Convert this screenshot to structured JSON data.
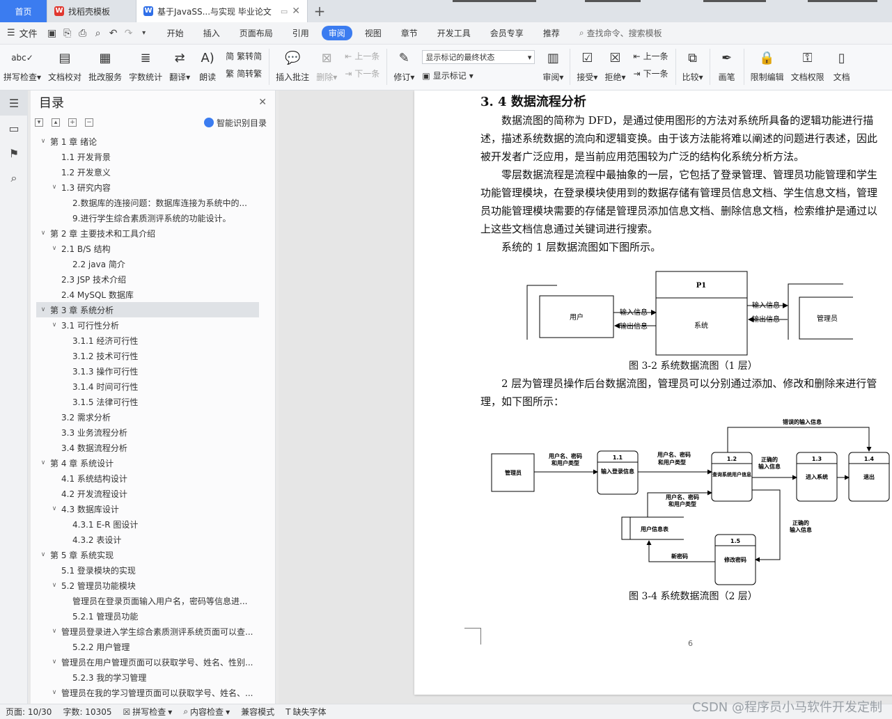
{
  "tabs": {
    "home": "首页",
    "t1": "找稻壳模板",
    "t2": "基于JavaSS...与实现 毕业论文"
  },
  "menu": {
    "file": "文件",
    "items": [
      "开始",
      "插入",
      "页面布局",
      "引用",
      "审阅",
      "视图",
      "章节",
      "开发工具",
      "会员专享",
      "推荐"
    ],
    "active_index": 4,
    "search": "查找命令、搜索模板"
  },
  "ribbon": {
    "spell": "拼写检查",
    "proof": "文档校对",
    "batch": "批改服务",
    "wordcount": "字数统计",
    "translate": "翻译",
    "read": "朗读",
    "trad": "繁转简",
    "simp": "简转繁",
    "insert_comment": "插入批注",
    "delete": "删除",
    "prev": "上一条",
    "next": "下一条",
    "revise": "修订",
    "markup_select": "显示标记的最终状态",
    "show_markup": "显示标记",
    "review": "审阅",
    "accept": "接受",
    "reject": "拒绝",
    "prev2": "上一条",
    "next2": "下一条",
    "compare": "比较",
    "pen": "画笔",
    "restrict": "限制编辑",
    "rights": "文档权限",
    "doc_more": "文档"
  },
  "toc": {
    "title": "目录",
    "smart": "智能识别目录",
    "items": [
      {
        "t": "第 1 章  绪论",
        "lv": 0,
        "car": "v"
      },
      {
        "t": "1.1 开发背景",
        "lv": 1,
        "car": ""
      },
      {
        "t": "1.2 开发意义",
        "lv": 1,
        "car": ""
      },
      {
        "t": "1.3 研究内容",
        "lv": 1,
        "car": "v"
      },
      {
        "t": "2.数据库的连接问题：数据库连接为系统中的...",
        "lv": 2,
        "car": ""
      },
      {
        "t": "9.进行学生综合素质测评系统的功能设计。",
        "lv": 2,
        "car": ""
      },
      {
        "t": "第 2 章  主要技术和工具介绍",
        "lv": 0,
        "car": "v"
      },
      {
        "t": "2.1 B/S 结构",
        "lv": 1,
        "car": "v"
      },
      {
        "t": "2.2 java 简介",
        "lv": 2,
        "car": ""
      },
      {
        "t": "2.3 JSP 技术介绍",
        "lv": 1,
        "car": ""
      },
      {
        "t": "2.4 MySQL 数据库",
        "lv": 1,
        "car": ""
      },
      {
        "t": "第 3 章  系统分析",
        "lv": 0,
        "car": "v",
        "sel": true
      },
      {
        "t": "3.1 可行性分析",
        "lv": 1,
        "car": "v"
      },
      {
        "t": "3.1.1 经济可行性",
        "lv": 2,
        "car": ""
      },
      {
        "t": "3.1.2 技术可行性",
        "lv": 2,
        "car": ""
      },
      {
        "t": "3.1.3 操作可行性",
        "lv": 2,
        "car": ""
      },
      {
        "t": "3.1.4  时间可行性",
        "lv": 2,
        "car": ""
      },
      {
        "t": "3.1.5  法律可行性",
        "lv": 2,
        "car": ""
      },
      {
        "t": "3.2 需求分析",
        "lv": 1,
        "car": ""
      },
      {
        "t": "3.3 业务流程分析",
        "lv": 1,
        "car": ""
      },
      {
        "t": "3.4 数据流程分析",
        "lv": 1,
        "car": ""
      },
      {
        "t": "第 4 章  系统设计",
        "lv": 0,
        "car": "v"
      },
      {
        "t": "4.1 系统结构设计",
        "lv": 1,
        "car": ""
      },
      {
        "t": "4.2 开发流程设计",
        "lv": 1,
        "car": ""
      },
      {
        "t": "4.3 数据库设计",
        "lv": 1,
        "car": "v"
      },
      {
        "t": "4.3.1 E-R 图设计",
        "lv": 2,
        "car": ""
      },
      {
        "t": "4.3.2 表设计",
        "lv": 2,
        "car": ""
      },
      {
        "t": "第 5 章    系统实现",
        "lv": 0,
        "car": "v"
      },
      {
        "t": "5.1 登录模块的实现",
        "lv": 1,
        "car": ""
      },
      {
        "t": "5.2 管理员功能模块",
        "lv": 1,
        "car": "v"
      },
      {
        "t": "管理员在登录页面输入用户名，密码等信息进...",
        "lv": 2,
        "car": ""
      },
      {
        "t": "5.2.1 管理员功能",
        "lv": 2,
        "car": ""
      },
      {
        "t": "管理员登录进入学生综合素质测评系统页面可以查...",
        "lv": 1,
        "car": "v"
      },
      {
        "t": "5.2.2 用户管理",
        "lv": 2,
        "car": ""
      },
      {
        "t": "管理员在用户管理页面可以获取学号、姓名、性别...",
        "lv": 1,
        "car": "v"
      },
      {
        "t": "5.2.3 我的学习管理",
        "lv": 2,
        "car": ""
      },
      {
        "t": "管理员在我的学习管理页面可以获取学号、姓名、...",
        "lv": 1,
        "car": "v"
      }
    ]
  },
  "doc": {
    "heading": "3. 4 数据流程分析",
    "p1": [
      "数据流图的简称为 DFD，是通过使用图形的方法对系统所具备的逻辑功能进行描",
      "述，描述系统数据的流向和逻辑变换。由于该方法能将难以阐述的问题进行表述，因此",
      "被开发者广泛应用，是当前应用范围较为广泛的结构化系统分析方法。"
    ],
    "p2": [
      "零层数据流程是流程中最抽象的一层，它包括了登录管理、管理员功能管理和学生",
      "功能管理模块，在登录模块使用到的数据存储有管理员信息文档、学生信息文档，管理",
      "员功能管理模块需要的存储是管理员添加信息文档、删除信息文档，检索维护是通过以",
      "上这些文档信息通过关键词进行搜索。"
    ],
    "p3": "系统的 1 层数据流图如下图所示。",
    "d1": {
      "user": "用户",
      "p1": "P1",
      "system": "系统",
      "admin": "管理员",
      "in1": "输入信息",
      "out1": "输出信息",
      "in2": "输入信息",
      "out2": "输出信息"
    },
    "cap1": "图 3-2 系统数据流图（1 层）",
    "p4": [
      "2 层为管理员操作后台数据流图，管理员可以分别通过添加、修改和删除来进行管",
      "理，如下图所示："
    ],
    "d2": {
      "admin": "管理员",
      "n11": "1.1",
      "n11t": "输入登录信息",
      "n12": "1.2",
      "n12t": "查询系统用户信息",
      "n13": "1.3",
      "n13t": "进入系统",
      "n14": "1.4",
      "n14t": "退出",
      "n15": "1.5",
      "n15t": "修改密码",
      "store": "用户信息表",
      "f1a": "用户名、密码",
      "f1b": "和用户类型",
      "f2a": "用户名、密码",
      "f2b": "和用户类型",
      "f3a": "用户名、密码",
      "f3b": "和用户类型",
      "wrong": "错误的输入信息",
      "c1a": "正确的",
      "c1b": "输入信息",
      "c2a": "正确的",
      "c2b": "输入信息",
      "newpwd": "新密码"
    },
    "cap2": "图 3-4 系统数据流图（2 层）",
    "pagenum": "6"
  },
  "status": {
    "page": "页面: 10/30",
    "words": "字数: 10305",
    "spell": "拼写检查",
    "content": "内容检查",
    "compat": "兼容模式",
    "font": "缺失字体"
  },
  "watermark": "CSDN @程序员小马软件开发定制"
}
